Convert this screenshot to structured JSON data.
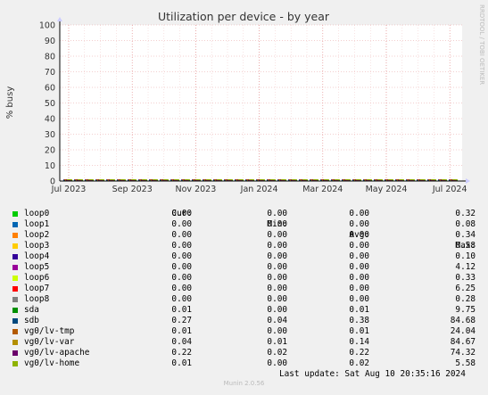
{
  "chart_data": {
    "type": "line",
    "title": "Utilization per device - by year",
    "ylabel": "% busy",
    "ylim": [
      0,
      100
    ],
    "yticks": [
      0,
      10,
      20,
      30,
      40,
      50,
      60,
      70,
      80,
      90,
      100
    ],
    "xticks": [
      "Jul 2023",
      "Sep 2023",
      "Nov 2023",
      "Jan 2024",
      "Mar 2024",
      "May 2024",
      "Jul 2024"
    ],
    "watermark": "RRDTOOL / TOBI OETIKER",
    "series": [
      {
        "name": "loop0",
        "color": "#00cc00"
      },
      {
        "name": "loop1",
        "color": "#0066b3"
      },
      {
        "name": "loop2",
        "color": "#ff8000"
      },
      {
        "name": "loop3",
        "color": "#ffcc00"
      },
      {
        "name": "loop4",
        "color": "#330099"
      },
      {
        "name": "loop5",
        "color": "#990099"
      },
      {
        "name": "loop6",
        "color": "#ccff00"
      },
      {
        "name": "loop7",
        "color": "#ff0000"
      },
      {
        "name": "loop8",
        "color": "#808080"
      },
      {
        "name": "sda",
        "color": "#008f00"
      },
      {
        "name": "sdb",
        "color": "#00487d"
      },
      {
        "name": "vg0/lv-tmp",
        "color": "#b35a00"
      },
      {
        "name": "vg0/lv-var",
        "color": "#b38f00"
      },
      {
        "name": "vg0/lv-apache",
        "color": "#6b006b"
      },
      {
        "name": "vg0/lv-home",
        "color": "#8fb300"
      }
    ]
  },
  "legend": {
    "headers": {
      "cur": "Cur:",
      "min": "Min:",
      "avg": "Avg:",
      "max": "Max:"
    },
    "rows": [
      {
        "name": "loop0",
        "cur": "0.00",
        "min": "0.00",
        "avg": "0.00",
        "max": "0.32"
      },
      {
        "name": "loop1",
        "cur": "0.00",
        "min": "0.00",
        "avg": "0.00",
        "max": "0.08"
      },
      {
        "name": "loop2",
        "cur": "0.00",
        "min": "0.00",
        "avg": "0.00",
        "max": "0.34"
      },
      {
        "name": "loop3",
        "cur": "0.00",
        "min": "0.00",
        "avg": "0.00",
        "max": "0.58"
      },
      {
        "name": "loop4",
        "cur": "0.00",
        "min": "0.00",
        "avg": "0.00",
        "max": "0.10"
      },
      {
        "name": "loop5",
        "cur": "0.00",
        "min": "0.00",
        "avg": "0.00",
        "max": "4.12"
      },
      {
        "name": "loop6",
        "cur": "0.00",
        "min": "0.00",
        "avg": "0.00",
        "max": "0.33"
      },
      {
        "name": "loop7",
        "cur": "0.00",
        "min": "0.00",
        "avg": "0.00",
        "max": "6.25"
      },
      {
        "name": "loop8",
        "cur": "0.00",
        "min": "0.00",
        "avg": "0.00",
        "max": "0.28"
      },
      {
        "name": "sda",
        "cur": "0.01",
        "min": "0.00",
        "avg": "0.01",
        "max": "9.75"
      },
      {
        "name": "sdb",
        "cur": "0.27",
        "min": "0.04",
        "avg": "0.38",
        "max": "84.68"
      },
      {
        "name": "vg0/lv-tmp",
        "cur": "0.01",
        "min": "0.00",
        "avg": "0.01",
        "max": "24.04"
      },
      {
        "name": "vg0/lv-var",
        "cur": "0.04",
        "min": "0.01",
        "avg": "0.14",
        "max": "84.67"
      },
      {
        "name": "vg0/lv-apache",
        "cur": "0.22",
        "min": "0.02",
        "avg": "0.22",
        "max": "74.32"
      },
      {
        "name": "vg0/lv-home",
        "cur": "0.01",
        "min": "0.00",
        "avg": "0.02",
        "max": "5.58"
      }
    ]
  },
  "footer": {
    "last_update": "Last update: Sat Aug 10 20:35:16 2024",
    "munin": "Munin 2.0.56"
  }
}
